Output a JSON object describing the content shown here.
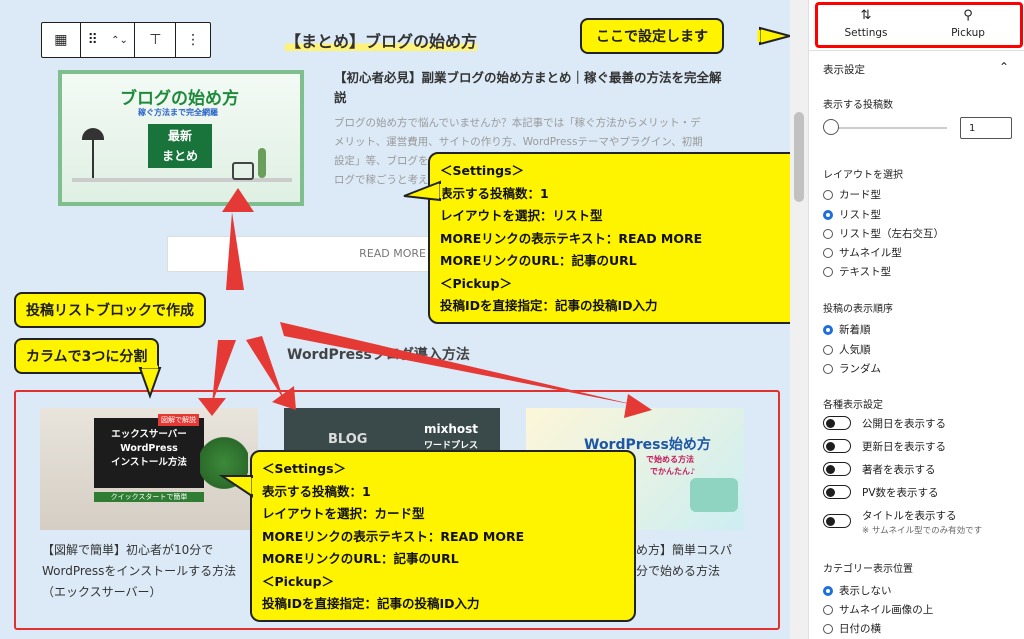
{
  "toolbar": {
    "block_icon": "▦",
    "drag_icon": "⠿",
    "move_icon": "⌃⌄",
    "transform_icon": "⊤",
    "more_icon": "⋮"
  },
  "post_list": {
    "heading": "【まとめ】ブログの始め方",
    "thumb_title": "ブログの始め方",
    "thumb_sub": "稼ぐ方法まで完全網羅",
    "thumb_badge_1": "最新",
    "thumb_badge_2": "まとめ",
    "title_line1": "【初心者必見】副業ブログの始め方まとめ｜稼ぐ最善の方法を完全解",
    "title_line2": "説",
    "excerpt_line1": "ブログの始め方で悩んでいませんか？本記事では「稼ぐ方法からメリット・デ",
    "excerpt_line2": "メリット、運営費用、サイトの作り方、WordPressテーマやプラグイン、初期",
    "excerpt_line3": "設定」等、ブログを",
    "excerpt_line4": "ログで稼ごうと考え",
    "read_more": "READ MORE"
  },
  "columns_section": {
    "heading": "WordPressブログ導入方法",
    "col1": {
      "img_tag": "図解で解説",
      "img_line1": "エックスサーバー",
      "img_line2": "WordPress",
      "img_line3": "インストール方法",
      "img_footer": "クイックスタートで簡単",
      "title_line1": "【図解で簡単】初心者が10分で",
      "title_line2": "WordPressをインストールする方法",
      "title_line3": "（エックスサーバー）"
    },
    "col2": {
      "img_word1": "BLOG",
      "img_word2": "mixhost",
      "img_word3": "ワードプレス"
    },
    "col3": {
      "img_line1": "WordPress始め方",
      "img_line2": "で始める方法",
      "img_line3": "でかんたん♪",
      "title_line1": "め方】簡単コスパ",
      "title_line2": "分で始める方法"
    }
  },
  "callouts": {
    "set_here": "ここで設定します",
    "post_list_block": "投稿リストブロックで作成",
    "split_columns": "カラムで3つに分割",
    "top": [
      "＜Settings＞",
      "表示する投稿数：1",
      "レイアウトを選択：リスト型",
      "MOREリンクの表示テキスト：READ MORE",
      "MOREリンクのURL：記事のURL",
      "＜Pickup＞",
      "投稿IDを直接指定：記事の投稿ID入力"
    ],
    "bottom": [
      "＜Settings＞",
      "表示する投稿数：1",
      "レイアウトを選択：カード型",
      "MOREリンクの表示テキスト：READ MORE",
      "MOREリンクのURL：記事のURL",
      "＜Pickup＞",
      "投稿IDを直接指定：記事の投稿ID入力"
    ]
  },
  "sidebar": {
    "tab_settings": "Settings",
    "tab_pickup": "Pickup",
    "settings_icon": "⇅",
    "pickup_icon": "⚲",
    "panel_title": "表示設定",
    "collapse_icon": "⌃",
    "post_count_label": "表示する投稿数",
    "post_count_value": "1",
    "layout_label": "レイアウトを選択",
    "layouts": [
      "カード型",
      "リスト型",
      "リスト型（左右交互）",
      "サムネイル型",
      "テキスト型"
    ],
    "order_label": "投稿の表示順序",
    "orders": [
      "新着順",
      "人気順",
      "ランダム"
    ],
    "display_label": "各種表示設定",
    "toggles": [
      "公開日を表示する",
      "更新日を表示する",
      "著者を表示する",
      "PV数を表示する",
      "タイトルを表示する"
    ],
    "toggle_note": "※ サムネイル型でのみ有効です",
    "category_label": "カテゴリー表示位置",
    "categories": [
      "表示しない",
      "サムネイル画像の上",
      "日付の横"
    ]
  },
  "colors": {
    "callout": "#fff400",
    "arrow": "#e53935",
    "accent": "#1d6fdb",
    "canvas": "#dceaf8"
  }
}
